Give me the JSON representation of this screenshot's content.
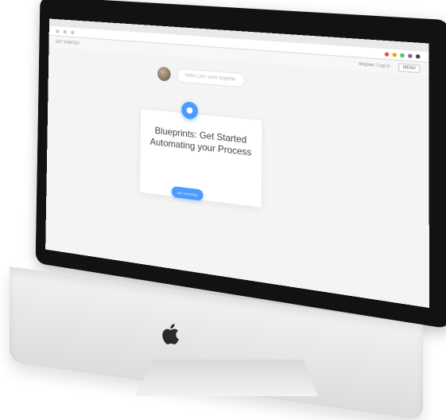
{
  "browser": {
    "tab_label": "",
    "url": "",
    "breadcrumb": "GET STARTED"
  },
  "app_bar": {
    "left": "",
    "right_link": "Register / Log In",
    "menu_label": "MENU"
  },
  "chat": {
    "bubble_text": "Hello! Let's work together"
  },
  "card": {
    "title_line1": "Blueprints: Get Started",
    "title_line2": "Automating your Process",
    "description": "",
    "step_1": "",
    "step_2": "",
    "cta_label": "GET STARTED",
    "footer_note": ""
  },
  "colors": {
    "accent": "#4e9bff",
    "bezel": "#111214",
    "screen_bg": "#f4f4f4"
  },
  "icons": {
    "apple_logo": "apple-logo",
    "lightbulb": "lightbulb-icon"
  }
}
